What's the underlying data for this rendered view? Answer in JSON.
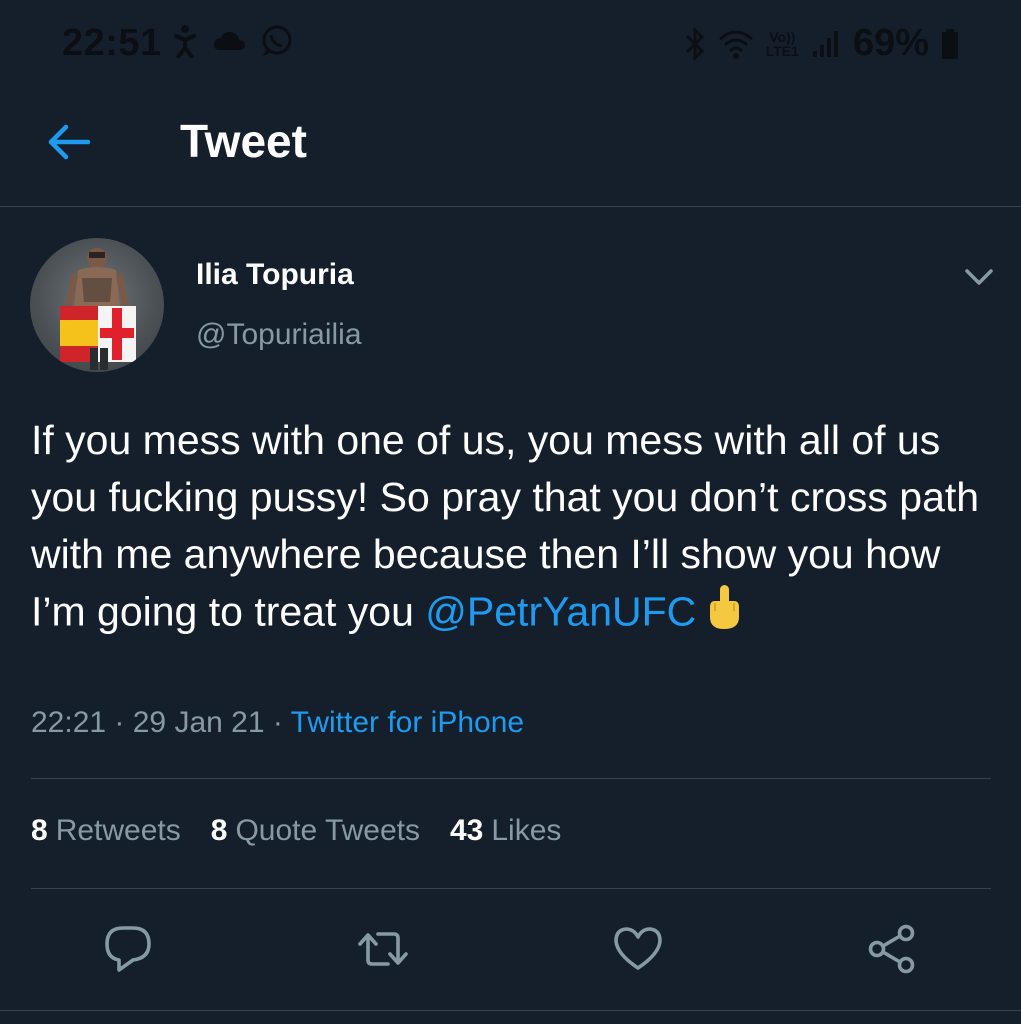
{
  "status": {
    "time": "22:51",
    "lte_top": "Vo))",
    "lte_bottom": "LTE1",
    "battery": "69%"
  },
  "header": {
    "title": "Tweet"
  },
  "tweet": {
    "author_name": "Ilia Topuria",
    "author_handle": "@Topuriailia",
    "text": "If you mess with one of us, you mess with all of us you fucking pussy! So pray that you don’t cross path with me anywhere because then I’ll show you how I’m going to treat you",
    "mention": "@PetrYanUFC",
    "time": "22:21",
    "separator": " · ",
    "date": "29 Jan 21",
    "source": "Twitter for iPhone"
  },
  "stats": [
    {
      "count": "8",
      "label": "Retweets"
    },
    {
      "count": "8",
      "label": "Quote Tweets"
    },
    {
      "count": "43",
      "label": "Likes"
    }
  ],
  "colors": {
    "background": "#151f2b",
    "accent": "#1d9bf0",
    "secondary_text": "#8899a6",
    "divider": "#38444d"
  },
  "icons": {
    "back": "arrow-left-icon",
    "more": "chevron-down-icon",
    "reply": "reply-icon",
    "retweet": "retweet-icon",
    "like": "heart-icon",
    "share": "share-icon"
  }
}
